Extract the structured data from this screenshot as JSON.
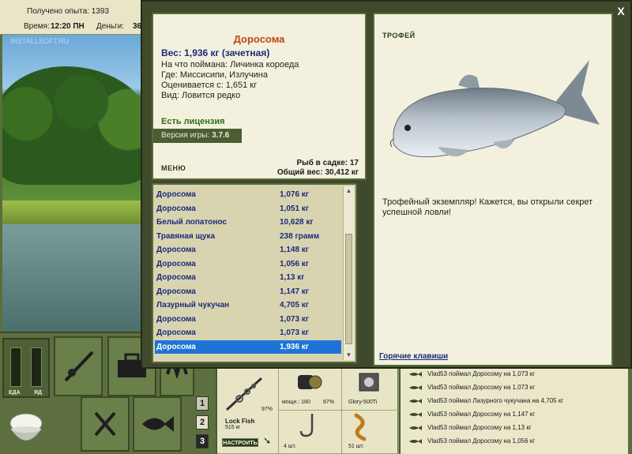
{
  "status": {
    "experience": "Получено опыта: 1393",
    "time_label": "Время:",
    "time_value": "12:20 ПН",
    "money_label": "Деньги:",
    "money_value": "36"
  },
  "scene": {
    "watermark": "INSTALLSOFT.RU"
  },
  "controls": {
    "food_label": "ЕДА",
    "poison_label": "ЯД",
    "slots": [
      "1",
      "2",
      "3"
    ]
  },
  "inventory": {
    "rod_name": "Lock Fish",
    "rod_weight": "515 кг",
    "rod_percent": "97%",
    "reel_power": "мощн.: 180",
    "reel_percent": "87%",
    "line_name": "Glory-500Ti",
    "hook_count": "4 шт.",
    "bait_count": "51 шт.",
    "setup_button": "НАСТРОИТЬ"
  },
  "chat": [
    "Vlad53 поймал Доросому на 1,073 кг",
    "Vlad53 поймал Доросому на 1,073 кг",
    "Vlad53 поймал Лазурного чукучана на 4,705 кг",
    "Vlad53 поймал Доросому на 1,147 кг",
    "Vlad53 поймал Доросому на 1,13 кг",
    "Vlad53 поймал Доросому на 1,056 кг"
  ],
  "dialog": {
    "close": "X",
    "fish_name": "Доросома",
    "weight": "Вес: 1,936 кг (зачетная)",
    "caught_on": "На что поймана: Личинка короеда",
    "where": "Где: Миссисипи, Излучина",
    "rated_from": "Оценивается с: 1,651 кг",
    "kind": "Вид: Ловится редко",
    "license": "Есть лицензия",
    "version_label": "Версия игры:",
    "version_value": "3.7.6",
    "menu": "МЕНЮ",
    "cage_count": "Рыб в садке: 17",
    "cage_weight": "Общий вес: 30,412 кг",
    "trophy_title": "ТРОФЕЙ",
    "trophy_text": "Трофейный экземпляр! Кажется, вы открыли секрет успешной ловли!",
    "hotkeys": "Горячие клавиши"
  },
  "catch_list": [
    {
      "name": "Доросома",
      "weight": "1,076 кг"
    },
    {
      "name": "Доросома",
      "weight": "1,051 кг"
    },
    {
      "name": "Белый лопатонос",
      "weight": "10,628 кг"
    },
    {
      "name": "Травяная щука",
      "weight": "238 грамм"
    },
    {
      "name": "Доросома",
      "weight": "1,148 кг"
    },
    {
      "name": "Доросома",
      "weight": "1,056 кг"
    },
    {
      "name": "Доросома",
      "weight": "1,13 кг"
    },
    {
      "name": "Доросома",
      "weight": "1,147 кг"
    },
    {
      "name": "Лазурный чукучан",
      "weight": "4,705 кг"
    },
    {
      "name": "Доросома",
      "weight": "1,073 кг"
    },
    {
      "name": "Доросома",
      "weight": "1,073 кг"
    },
    {
      "name": "Доросома",
      "weight": "1,936 кг",
      "selected": true
    }
  ],
  "colors": {
    "selected_row": "#1e73d6",
    "fish_name": "#c0461a",
    "weight_text": "#1b2b7a",
    "license": "#2f6b1a"
  }
}
